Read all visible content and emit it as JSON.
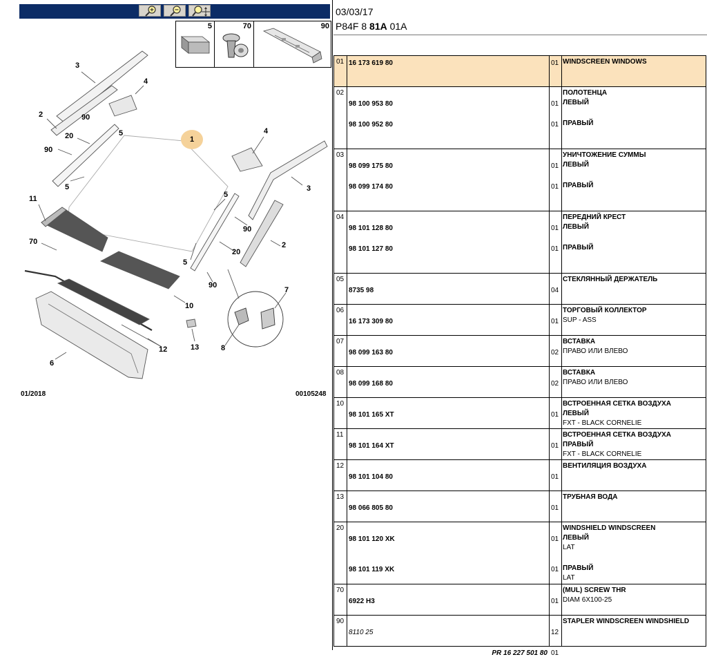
{
  "toolbar": {
    "zoom_in_icon": "zoom-in-icon",
    "zoom_out_icon": "zoom-out-icon",
    "zoom_fit_icon": "zoom-move-icon"
  },
  "thumbnails": [
    {
      "num": "5"
    },
    {
      "num": "70"
    },
    {
      "num": "90"
    }
  ],
  "diagram": {
    "badge": "1",
    "callouts": [
      "3",
      "4",
      "2",
      "90",
      "5",
      "20",
      "90",
      "5",
      "4",
      "3",
      "5",
      "90",
      "2",
      "11",
      "70",
      "20",
      "5",
      "90",
      "10",
      "7",
      "12",
      "13",
      "8",
      "6"
    ],
    "date": "01/2018",
    "code": "00105248"
  },
  "header": {
    "date": "03/03/17",
    "code_prefix": "P84F 8 ",
    "code_bold": "81A",
    "code_suffix": " 01A"
  },
  "rows": [
    {
      "idx": "01",
      "lines": [
        {
          "pn": "16 173 619 80",
          "qty": "01",
          "desc": "WINDSCREEN WINDOWS",
          "bold": true
        }
      ]
    },
    {
      "idx": "02",
      "lines": [
        {
          "desc": "ПОЛОТЕНЦА",
          "bold": true
        },
        {
          "pn": "98 100 953 80",
          "qty": "01",
          "desc": "ЛЕВЫЙ",
          "bold": true
        },
        {
          "pn": "98 100 952 80",
          "qty": "01",
          "desc": "ПРАВЫЙ",
          "bold": true
        }
      ]
    },
    {
      "idx": "03",
      "lines": [
        {
          "desc": "УНИЧТОЖЕНИЕ СУММЫ",
          "bold": true
        },
        {
          "pn": "98 099 175 80",
          "qty": "01",
          "desc": "ЛЕВЫЙ",
          "bold": true
        },
        {
          "pn": "98 099 174 80",
          "qty": "01",
          "desc": "ПРАВЫЙ",
          "bold": true
        }
      ]
    },
    {
      "idx": "04",
      "lines": [
        {
          "desc": "ПЕРЕДНИЙ КРЕСТ",
          "bold": true
        },
        {
          "pn": "98 101 128 80",
          "qty": "01",
          "desc": "ЛЕВЫЙ",
          "bold": true
        },
        {
          "pn": "98 101 127 80",
          "qty": "01",
          "desc": "ПРАВЫЙ",
          "bold": true
        }
      ]
    },
    {
      "idx": "05",
      "lines": [
        {
          "desc": "СТЕКЛЯННЫЙ ДЕРЖАТЕЛЬ",
          "bold": true
        },
        {
          "pn": "8735 98",
          "qty": "04"
        }
      ]
    },
    {
      "idx": "06",
      "lines": [
        {
          "desc": "ТОРГОВЫЙ КОЛЛЕКТОР",
          "bold": true
        },
        {
          "pn": "16 173 309 80",
          "qty": "01",
          "desc": "SUP - ASS",
          "bold": false
        }
      ]
    },
    {
      "idx": "07",
      "lines": [
        {
          "desc": "ВСТАВКА",
          "bold": true
        },
        {
          "pn": "98 099 163 80",
          "qty": "02",
          "desc": "ПРАВО ИЛИ ВЛЕВО",
          "bold": false
        }
      ]
    },
    {
      "idx": "08",
      "lines": [
        {
          "desc": "ВСТАВКА",
          "bold": true
        },
        {
          "pn": "98 099 168 80",
          "qty": "02",
          "desc": "ПРАВО ИЛИ ВЛЕВО",
          "bold": false
        }
      ]
    },
    {
      "idx": "10",
      "lines": [
        {
          "desc": "ВСТРОЕННАЯ СЕТКА ВОЗДУХА",
          "bold": true
        },
        {
          "pn": "98 101 165 XT",
          "qty": "01",
          "desc": "ЛЕВЫЙ",
          "bold": true
        },
        {
          "desc": "FXT - BLACK CORNELIE",
          "bold": false
        }
      ]
    },
    {
      "idx": "11",
      "lines": [
        {
          "desc": "ВСТРОЕННАЯ СЕТКА ВОЗДУХА",
          "bold": true
        },
        {
          "pn": "98 101 164 XT",
          "qty": "01",
          "desc": "ПРАВЫЙ",
          "bold": true
        },
        {
          "desc": "FXT - BLACK CORNELIE",
          "bold": false
        }
      ]
    },
    {
      "idx": "12",
      "lines": [
        {
          "desc": "ВЕНТИЛЯЦИЯ ВОЗДУХА",
          "bold": true
        },
        {
          "pn": "98 101 104 80",
          "qty": "01"
        }
      ]
    },
    {
      "idx": "13",
      "lines": [
        {
          "desc": "ТРУБНАЯ ВОДА",
          "bold": true
        },
        {
          "pn": "98 066 805 80",
          "qty": "01"
        }
      ]
    },
    {
      "idx": "20",
      "lines": [
        {
          "desc": "WINDSHIELD WINDSCREEN",
          "bold": true
        },
        {
          "pn": "98 101 120 XK",
          "qty": "01",
          "desc": "ЛЕВЫЙ",
          "bold": true
        },
        {
          "desc": "LAT",
          "bold": false
        },
        {
          "pn": "98 101 119 XK",
          "qty": "01",
          "desc": "ПРАВЫЙ",
          "bold": true
        },
        {
          "desc": "LAT",
          "bold": false
        }
      ]
    },
    {
      "idx": "70",
      "lines": [
        {
          "desc": "(MUL) SCREW THR",
          "bold": true
        },
        {
          "pn": "6922 H3",
          "qty": "01",
          "desc": "DIAM 6X100-25",
          "bold": false
        }
      ]
    },
    {
      "idx": "90",
      "lines": [
        {
          "desc": "STAPLER WINDSCREEN WINDSHIELD",
          "bold": true
        },
        {
          "pn": "8110 25",
          "qty": "12",
          "italic": true
        },
        {
          "pr": "PR 16 227 501 80",
          "qty": "01"
        }
      ]
    }
  ]
}
